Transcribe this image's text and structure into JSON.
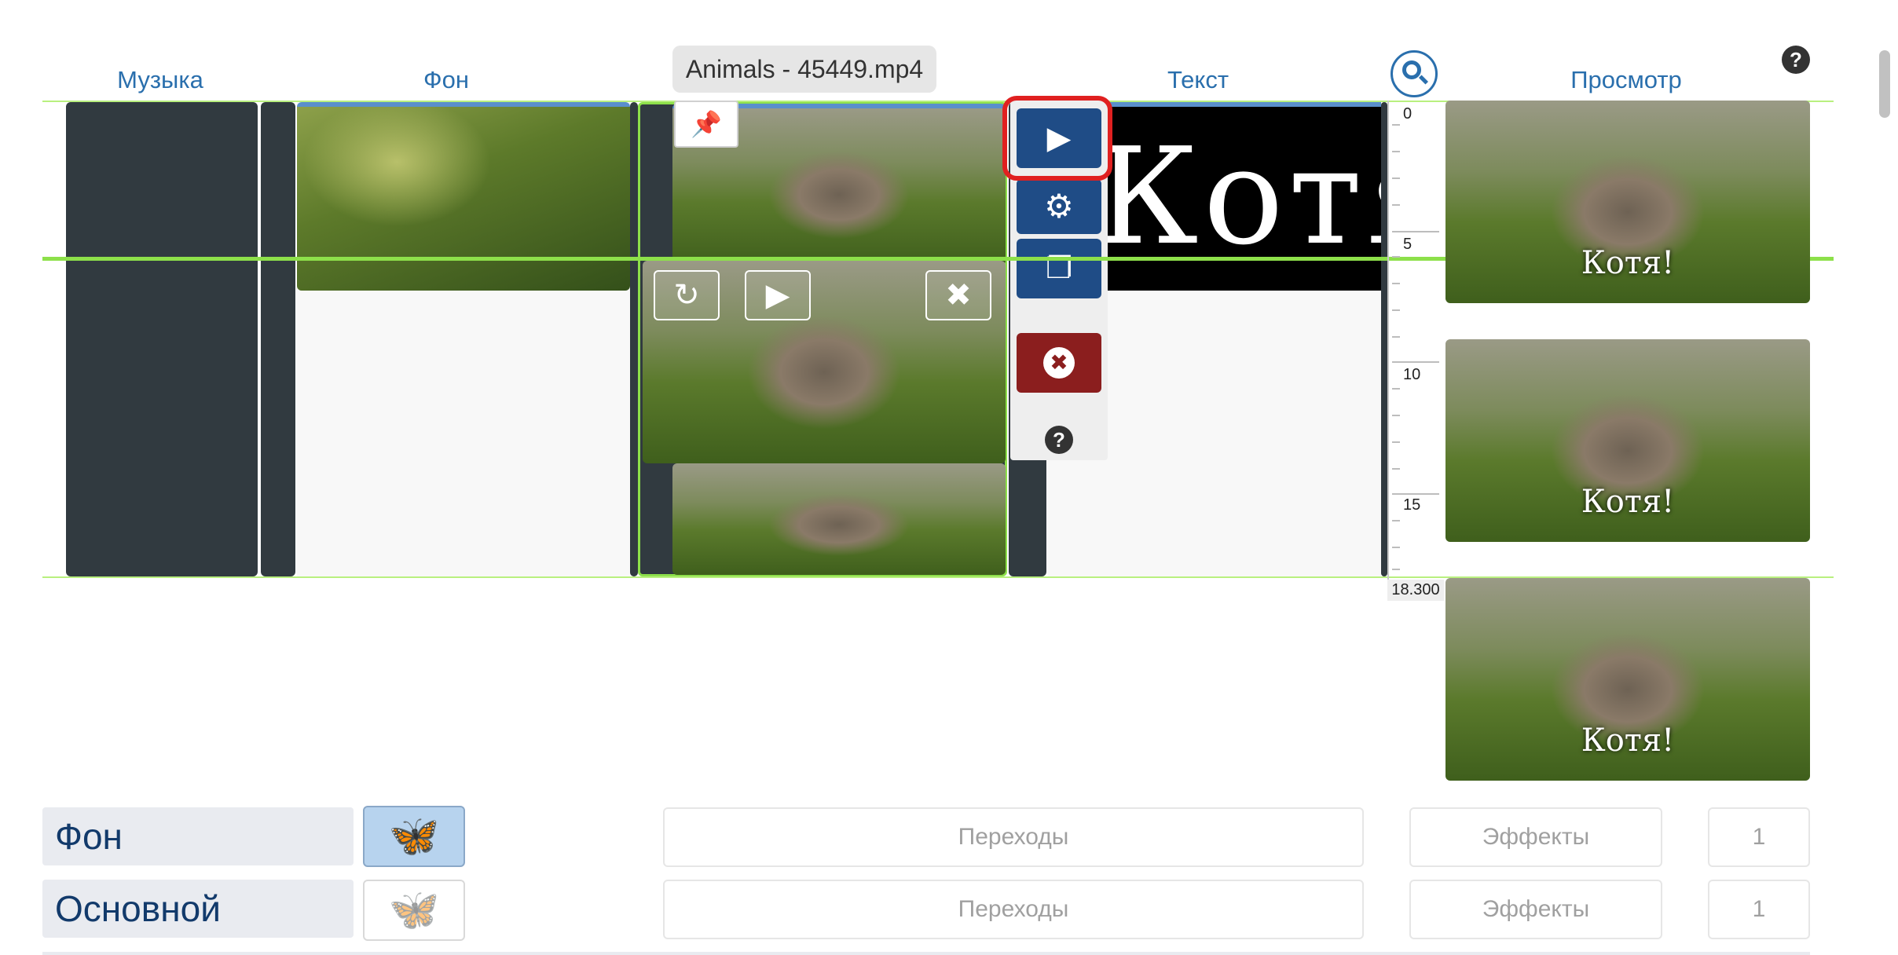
{
  "headers": {
    "music": "Музыка",
    "background": "Фон",
    "file": "Animals - 45449.mp4",
    "text": "Текст",
    "preview": "Просмотр"
  },
  "text_track": {
    "caption": "Котя!"
  },
  "toolbar": {
    "play_icon": "play-icon",
    "settings_icon": "gear-icon",
    "copy_icon": "copy-icon",
    "delete_icon": "close-circle-icon",
    "help_icon": "question-icon"
  },
  "clip_overlay": {
    "refresh_icon": "refresh-icon",
    "play_icon": "play-icon",
    "close_icon": "close-icon",
    "pin_icon": "pin-icon"
  },
  "ruler": {
    "labels": [
      "0",
      "5",
      "10",
      "15",
      "18.300"
    ]
  },
  "preview_frames": [
    {
      "caption": "Котя!"
    },
    {
      "caption": "Котя!"
    },
    {
      "caption": "Котя!"
    }
  ],
  "rows": [
    {
      "label": "Фон",
      "transitions": "Переходы",
      "effects": "Эффекты",
      "count": "1"
    },
    {
      "label": "Основной",
      "transitions": "Переходы",
      "effects": "Эффекты",
      "count": "1"
    }
  ],
  "colors": {
    "accent": "#2a6fad",
    "toolbar_blue": "#1f4c86",
    "delete_red": "#8b1e1e",
    "guide_green": "#8de04a",
    "highlight_red": "#e02020"
  }
}
